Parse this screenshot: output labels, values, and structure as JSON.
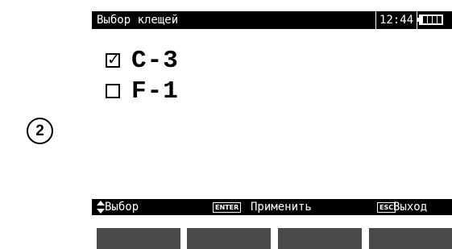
{
  "step_badge": "2",
  "header": {
    "title": "Выбор клещей",
    "time": "12:44",
    "battery_level": 1.0
  },
  "options": [
    {
      "label": "C-3",
      "checked": true
    },
    {
      "label": "F-1",
      "checked": false
    }
  ],
  "status_bar": {
    "select_hint": "Выбор",
    "enter_key": "ENTER",
    "apply_hint": "Применить",
    "esc_key": "ESC",
    "exit_hint": "Выход"
  },
  "softkeys": [
    "",
    "",
    "",
    ""
  ],
  "colors": {
    "screen_bg": "#ffffff",
    "bar_bg": "#000000",
    "softkey": "#4a4a4a"
  }
}
